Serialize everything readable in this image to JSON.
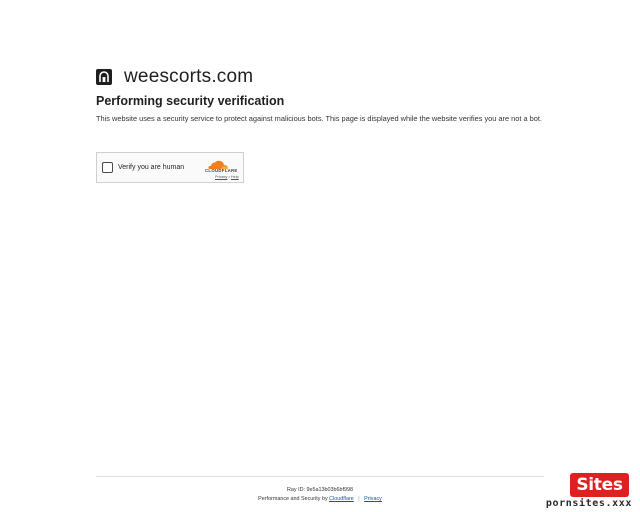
{
  "site": {
    "domain": "weescorts.com",
    "favicon_icon": "site-favicon-icon"
  },
  "page": {
    "heading": "Performing security verification",
    "description": "This website uses a security service to protect against malicious bots. This page is displayed while the website verifies you are not a bot."
  },
  "captcha": {
    "checkbox_label": "Verify you are human",
    "brand": "CLOUDFLARE",
    "privacy_link": "Privacy",
    "separator": "•",
    "help_link": "Help",
    "brand_color": "#f38020"
  },
  "footer": {
    "ray_id": "Ray ID: 9e5a13b03b6bf998",
    "perf_prefix": "Performance and Security by",
    "cloudflare_link": "Cloudflare",
    "separator": "|",
    "privacy_link": "Privacy"
  },
  "watermark": {
    "badge": "Sites",
    "text": "pornsites.xxx",
    "badge_color": "#e02020"
  }
}
